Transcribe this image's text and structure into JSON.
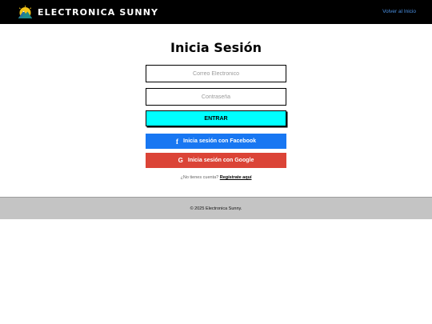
{
  "header": {
    "brand": "ELECTRONICA SUNNY",
    "back_link": "Volver al Inicio",
    "logo_icon": "sun-mountain-logo",
    "background_color": "#000000",
    "link_color": "#4a90e2"
  },
  "login": {
    "title": "Inicia Sesión",
    "email_placeholder": "Correo Electronico",
    "password_placeholder": "Contraseña",
    "submit_label": "ENTRAR",
    "submit_color": "#00ffff",
    "facebook_label": "Inicia sesión con Facebook",
    "facebook_icon": "f",
    "facebook_color": "#1877f2",
    "google_label": "Inicia sesión con Google",
    "google_icon": "G",
    "google_color": "#db4437",
    "register_prompt": "¿No tienes cuenta?",
    "register_link": "Regístrate aquí"
  },
  "footer": {
    "copyright": "© 2025 Electronica Sunny.",
    "background_color": "#c4c4c4"
  }
}
